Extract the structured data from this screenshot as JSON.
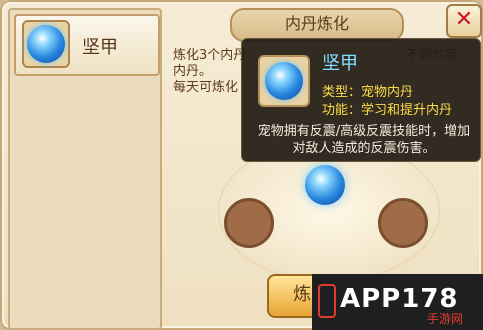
{
  "window": {
    "title": "内丹炼化",
    "close_icon": "close-icon"
  },
  "list": {
    "items": [
      {
        "name": "坚甲",
        "icon": "pet-core-orb-icon"
      }
    ]
  },
  "description": {
    "line1_visible": "炼化3个内丹",
    "line1_tail": "不同的新内丹。",
    "line2_visible": "每天可炼化"
  },
  "refine_button": {
    "label": "炼 化"
  },
  "tooltip": {
    "name": "坚甲",
    "type_line": "类型：宠物内丹",
    "function_line": "功能：学习和提升内丹",
    "description": "宠物拥有反震/高级反震技能时，增加对敌人造成的反震伤害。"
  },
  "watermark": {
    "brand": "APP178",
    "sub": "手游网"
  },
  "colors": {
    "tooltip_name": "#7fe1ff",
    "tooltip_info": "#ffde47",
    "close": "#d0161e"
  }
}
